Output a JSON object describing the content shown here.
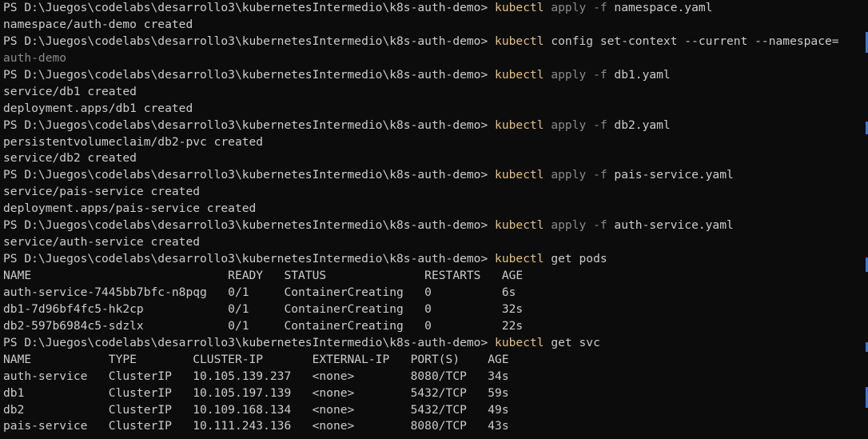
{
  "lines": [
    {
      "type": "cmd",
      "prompt": "PS D:\\Juegos\\codelabs\\desarrollo3\\kubernetesIntermedio\\k8s-auth-demo> ",
      "cmd": "kubectl",
      "flag": " apply -f",
      "args": " namespace.yaml"
    },
    {
      "type": "out",
      "text": "namespace/auth-demo created"
    },
    {
      "type": "cmd",
      "prompt": "PS D:\\Juegos\\codelabs\\desarrollo3\\kubernetesIntermedio\\k8s-auth-demo> ",
      "cmd": "kubectl",
      "flag": "",
      "args": " config set-context --current --namespace="
    },
    {
      "type": "dim",
      "text": "auth-demo"
    },
    {
      "type": "cmd",
      "prompt": "PS D:\\Juegos\\codelabs\\desarrollo3\\kubernetesIntermedio\\k8s-auth-demo> ",
      "cmd": "kubectl",
      "flag": " apply -f",
      "args": " db1.yaml"
    },
    {
      "type": "out",
      "text": "service/db1 created"
    },
    {
      "type": "out",
      "text": "deployment.apps/db1 created"
    },
    {
      "type": "cmd",
      "prompt": "PS D:\\Juegos\\codelabs\\desarrollo3\\kubernetesIntermedio\\k8s-auth-demo> ",
      "cmd": "kubectl",
      "flag": " apply -f",
      "args": " db2.yaml"
    },
    {
      "type": "out",
      "text": "persistentvolumeclaim/db2-pvc created"
    },
    {
      "type": "out",
      "text": "service/db2 created"
    },
    {
      "type": "cmd",
      "prompt": "PS D:\\Juegos\\codelabs\\desarrollo3\\kubernetesIntermedio\\k8s-auth-demo> ",
      "cmd": "kubectl",
      "flag": " apply -f",
      "args": " pais-service.yaml"
    },
    {
      "type": "out",
      "text": "service/pais-service created"
    },
    {
      "type": "out",
      "text": "deployment.apps/pais-service created"
    },
    {
      "type": "cmd",
      "prompt": "PS D:\\Juegos\\codelabs\\desarrollo3\\kubernetesIntermedio\\k8s-auth-demo> ",
      "cmd": "kubectl",
      "flag": " apply -f",
      "args": " auth-service.yaml"
    },
    {
      "type": "out",
      "text": "service/auth-service created"
    },
    {
      "type": "cmd",
      "prompt": "PS D:\\Juegos\\codelabs\\desarrollo3\\kubernetesIntermedio\\k8s-auth-demo> ",
      "cmd": "kubectl",
      "flag": "",
      "args": " get pods"
    },
    {
      "type": "out",
      "text": "NAME                            READY   STATUS              RESTARTS   AGE"
    },
    {
      "type": "out",
      "text": "auth-service-7445bb7bfc-n8pqg   0/1     ContainerCreating   0          6s"
    },
    {
      "type": "out",
      "text": "db1-7d96bf4fc5-hk2cp            0/1     ContainerCreating   0          32s"
    },
    {
      "type": "out",
      "text": "db2-597b6984c5-sdzlx            0/1     ContainerCreating   0          22s"
    },
    {
      "type": "cmd",
      "prompt": "PS D:\\Juegos\\codelabs\\desarrollo3\\kubernetesIntermedio\\k8s-auth-demo> ",
      "cmd": "kubectl",
      "flag": "",
      "args": " get svc"
    },
    {
      "type": "out",
      "text": "NAME           TYPE        CLUSTER-IP       EXTERNAL-IP   PORT(S)    AGE"
    },
    {
      "type": "out",
      "text": "auth-service   ClusterIP   10.105.139.237   <none>        8080/TCP   34s"
    },
    {
      "type": "out",
      "text": "db1            ClusterIP   10.105.197.139   <none>        5432/TCP   59s"
    },
    {
      "type": "out",
      "text": "db2            ClusterIP   10.109.168.134   <none>        5432/TCP   49s"
    },
    {
      "type": "out",
      "text": "pais-service   ClusterIP   10.111.243.136   <none>        8080/TCP   43s"
    }
  ],
  "colors": {
    "background": "#0c0c0c",
    "text": "#cccccc",
    "command": "#e5c07b",
    "flag": "#8a8a8a",
    "scroll_marker": "#3a7bd5"
  }
}
